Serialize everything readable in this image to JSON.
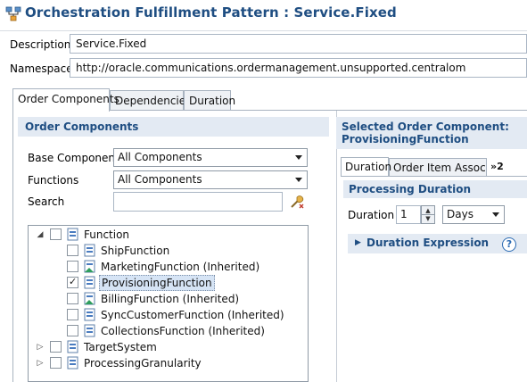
{
  "header": {
    "title": "Orchestration Fulfillment Pattern : Service.Fixed",
    "title_icon": "orchestration-pattern-icon"
  },
  "form": {
    "description_label": "Description",
    "description_value": "Service.Fixed",
    "namespace_label": "Namespace",
    "namespace_value": "http://oracle.communications.ordermanagement.unsupported.centralom"
  },
  "tabs": [
    {
      "label": "Order Components",
      "active": true
    },
    {
      "label": "Dependencies",
      "active": false
    },
    {
      "label": "Duration",
      "active": false
    }
  ],
  "left_panel": {
    "title": "Order Components",
    "base_component_label": "Base Component",
    "base_component_value": "All Components",
    "functions_label": "Functions",
    "functions_value": "All Components",
    "search_label": "Search",
    "search_value": "",
    "search_icon": "clear-search-icon",
    "tree": [
      {
        "label": "Function",
        "level": 0,
        "expanded": true,
        "checked": false
      },
      {
        "label": "ShipFunction",
        "level": 1,
        "checked": false
      },
      {
        "label": "MarketingFunction (Inherited)",
        "level": 1,
        "checked": false,
        "inherited": true
      },
      {
        "label": "ProvisioningFunction",
        "level": 1,
        "checked": true,
        "selected": true
      },
      {
        "label": "BillingFunction (Inherited)",
        "level": 1,
        "checked": false,
        "inherited": true
      },
      {
        "label": "SyncCustomerFunction (Inherited)",
        "level": 1,
        "checked": false
      },
      {
        "label": "CollectionsFunction (Inherited)",
        "level": 1,
        "checked": false
      },
      {
        "label": "TargetSystem",
        "level": 0,
        "expanded": false,
        "checked": false
      },
      {
        "label": "ProcessingGranularity",
        "level": 0,
        "expanded": false,
        "checked": false
      }
    ]
  },
  "right_panel": {
    "title_line1": "Selected Order Component:",
    "title_line2": "ProvisioningFunction",
    "tabs": [
      {
        "label": "Duration",
        "active": true
      },
      {
        "label": "Order Item Associ...",
        "active": false
      },
      {
        "label": "»2",
        "active": false
      }
    ],
    "processing_duration_title": "Processing Duration",
    "duration_label": "Duration",
    "duration_value": "1",
    "duration_unit": "Days",
    "duration_expression_label": "Duration Expression",
    "help_icon": "help-icon"
  },
  "colors": {
    "title_blue": "#1f4e82",
    "panel_header_bg": "#e3eaf3",
    "selected_row_bg": "#d6e4f5"
  }
}
